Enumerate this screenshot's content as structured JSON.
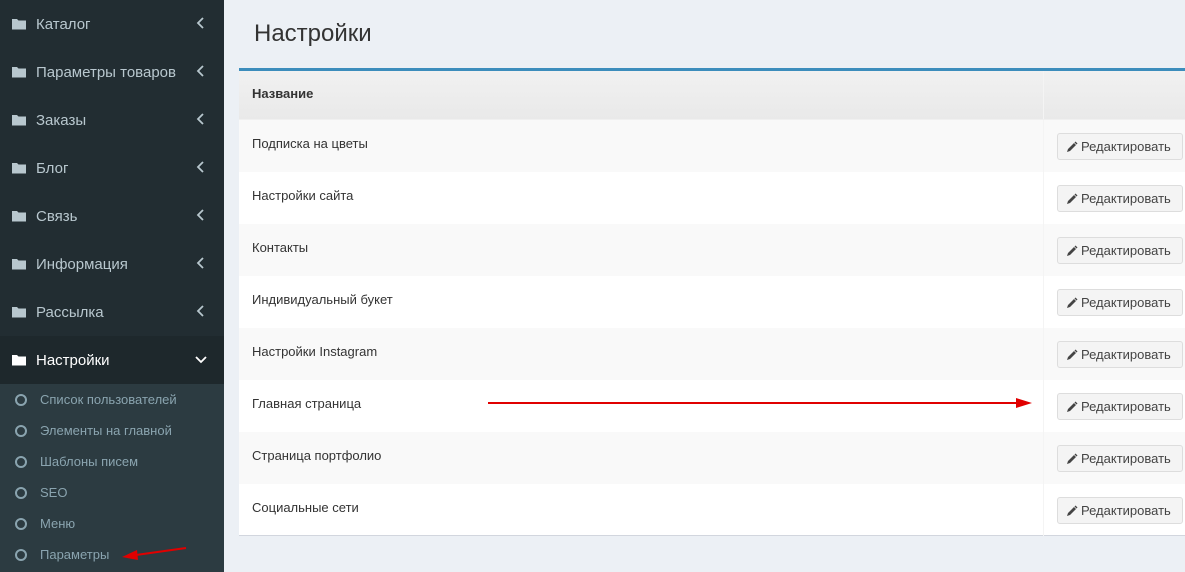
{
  "sidebar": {
    "menu": [
      {
        "label": "Каталог",
        "icon": "folder-icon",
        "chevron": "chevron-left-icon"
      },
      {
        "label": "Параметры товаров",
        "icon": "folder-icon",
        "chevron": "chevron-left-icon"
      },
      {
        "label": "Заказы",
        "icon": "folder-icon",
        "chevron": "chevron-left-icon"
      },
      {
        "label": "Блог",
        "icon": "folder-icon",
        "chevron": "chevron-left-icon"
      },
      {
        "label": "Связь",
        "icon": "folder-icon",
        "chevron": "chevron-left-icon"
      },
      {
        "label": "Информация",
        "icon": "folder-icon",
        "chevron": "chevron-left-icon"
      },
      {
        "label": "Рассылка",
        "icon": "folder-icon",
        "chevron": "chevron-left-icon"
      },
      {
        "label": "Настройки",
        "icon": "folder-icon",
        "chevron": "chevron-down-icon",
        "active": true
      }
    ],
    "submenu": [
      {
        "label": "Список пользователей",
        "icon": "circle-icon"
      },
      {
        "label": "Элементы на главной",
        "icon": "circle-icon"
      },
      {
        "label": "Шаблоны писем",
        "icon": "circle-icon"
      },
      {
        "label": "SEO",
        "icon": "circle-icon"
      },
      {
        "label": "Меню",
        "icon": "circle-icon"
      },
      {
        "label": "Параметры",
        "icon": "circle-icon"
      }
    ]
  },
  "main": {
    "title": "Настройки",
    "table": {
      "header": "Название",
      "action_label": "Редактировать",
      "rows": [
        {
          "name": "Подписка на цветы"
        },
        {
          "name": "Настройки сайта"
        },
        {
          "name": "Контакты"
        },
        {
          "name": "Индивидуальный букет"
        },
        {
          "name": "Настройки Instagram"
        },
        {
          "name": "Главная страница"
        },
        {
          "name": "Страница портфолио"
        },
        {
          "name": "Социальные сети"
        }
      ]
    }
  },
  "colors": {
    "sidebar_bg": "#222d32",
    "submenu_bg": "#2c3b41",
    "accent": "#3c8dbc",
    "annotation_arrow": "#e00000"
  }
}
